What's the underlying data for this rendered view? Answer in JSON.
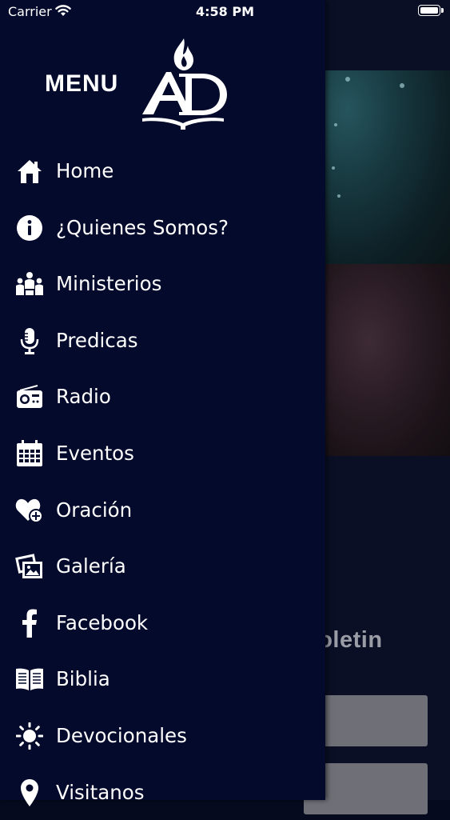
{
  "status_bar": {
    "carrier": "Carrier",
    "time": "4:58 PM"
  },
  "drawer": {
    "title": "MENU",
    "logo_text": "AD",
    "items": [
      {
        "label": "Home",
        "icon": "home-icon"
      },
      {
        "label": "¿Quienes Somos?",
        "icon": "info-icon"
      },
      {
        "label": "Ministerios",
        "icon": "people-icon"
      },
      {
        "label": "Predicas",
        "icon": "microphone-icon"
      },
      {
        "label": "Radio",
        "icon": "radio-icon"
      },
      {
        "label": "Eventos",
        "icon": "calendar-icon"
      },
      {
        "label": "Oración",
        "icon": "heart-plus-icon"
      },
      {
        "label": "Galería",
        "icon": "photos-icon"
      },
      {
        "label": "Facebook",
        "icon": "facebook-icon"
      },
      {
        "label": "Biblia",
        "icon": "book-icon"
      },
      {
        "label": "Devocionales",
        "icon": "sun-icon"
      },
      {
        "label": "Visitanos",
        "icon": "location-pin-icon"
      }
    ]
  },
  "background_page": {
    "section_label_partial": "boletin"
  },
  "colors": {
    "drawer_background": "#030a2b",
    "text": "#ffffff"
  }
}
